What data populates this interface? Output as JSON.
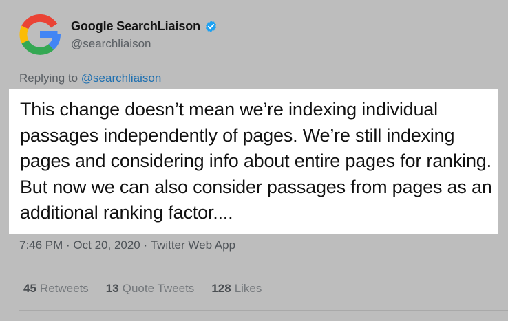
{
  "author": {
    "name": "Google SearchLiaison",
    "handle": "@searchliaison",
    "avatar_icon": "google-g-logo",
    "verified_icon": "verified-badge-icon"
  },
  "reply": {
    "prefix": "Replying to",
    "handle": "@searchliaison"
  },
  "tweet": {
    "text": "This change doesn’t mean we’re indexing individual passages independently of pages. We’re still indexing pages and considering info about entire pages for ranking. But now we can also consider passages from pages as an additional ranking factor...."
  },
  "meta": {
    "timestamp": "7:46 PM · Oct 20, 2020",
    "separator": "·",
    "source": "Twitter Web App"
  },
  "stats": [
    {
      "count": "45",
      "label": "Retweets"
    },
    {
      "count": "13",
      "label": "Quote Tweets"
    },
    {
      "count": "128",
      "label": "Likes"
    }
  ],
  "colors": {
    "background": "#bdbdbd",
    "highlight": "#ffffff",
    "link": "#1d6fb0",
    "verified": "#1da1f2"
  }
}
